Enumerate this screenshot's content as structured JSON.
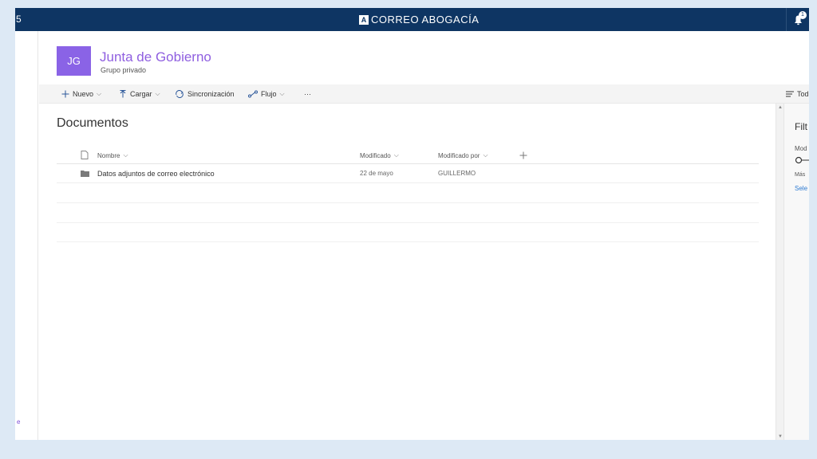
{
  "topbar": {
    "edge_glyph": "5",
    "brand_mark": "A",
    "brand_text": "CORREO ABOGACÍA",
    "notification_count": "1"
  },
  "left_strip": {
    "glyph": "e"
  },
  "site": {
    "initials": "JG",
    "title": "Junta de Gobierno",
    "subtitle": "Grupo privado"
  },
  "commandbar": {
    "new_label": "Nuevo",
    "upload_label": "Cargar",
    "sync_label": "Sincronización",
    "flow_label": "Flujo",
    "more_label": "···",
    "view_label": "Tod"
  },
  "library": {
    "title": "Documentos",
    "columns": {
      "name": "Nombre",
      "modified": "Modificado",
      "modified_by": "Modificado por"
    },
    "rows": [
      {
        "name": "Datos adjuntos de correo electrónico",
        "modified": "22 de mayo",
        "modified_by": "GUILLERMO"
      }
    ]
  },
  "filter_panel": {
    "title": "Filt",
    "label": "Mod",
    "more": "Más",
    "select": "Sele"
  },
  "colors": {
    "topbar": "#0e3563",
    "accent": "#8a63e6",
    "title_purple": "#8f5fe0",
    "page_bg": "#dde9f5"
  }
}
